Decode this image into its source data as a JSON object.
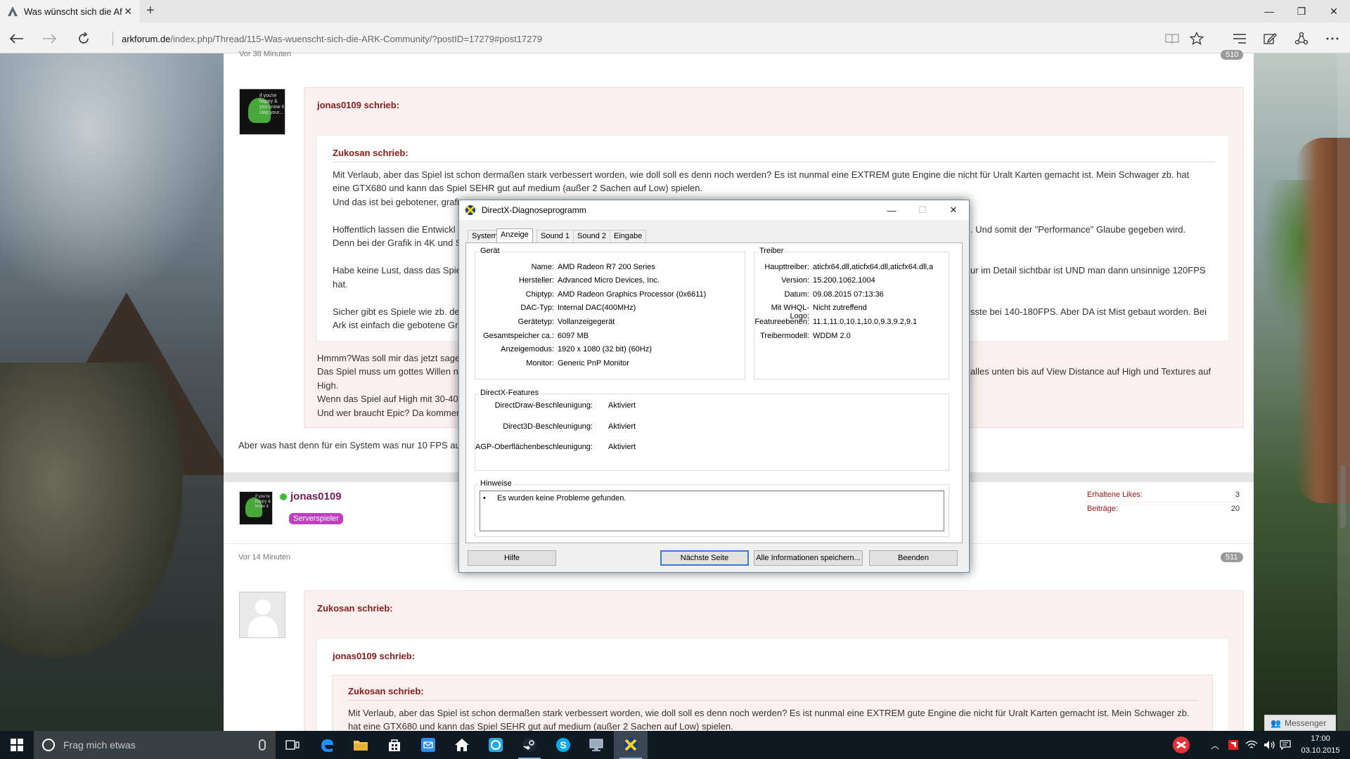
{
  "browser": {
    "tab_title": "Was wünscht sich die Af",
    "url_domain": "arkforum.de",
    "url_path": "/index.php/Thread/115-Was-wuenscht-sich-die-ARK-Community/?postID=17279#post17279"
  },
  "page": {
    "top_timestamp": "Vor 38 Minuten",
    "top_post_number": "510",
    "post1": {
      "outer_quote_author": "jonas0109 schrieb:",
      "inner_quote_author": "Zukosan schrieb:",
      "inner_quote_lines": [
        "Mit Verlaub, aber das Spiel ist schon dermaßen stark verbessert worden, wie doll soll es denn noch werden? Es ist nunmal eine EXTREM gute Engine die nicht für Uralt Karten gemacht ist. Mein Schwager zb. hat",
        "eine GTX680 und kann das Spiel SEHR gut auf medium (außer 2 Sachen auf Low) spielen.",
        "Und das ist bei gebotener, grafi",
        "Hoffentlich lassen die Entwickl",
        "Denn bei der Grafik in 4K und S",
        "Habe keine Lust, dass das Spie",
        "hat.",
        "Sicher gibt es Spiele wie zb. de",
        "Ark ist einfach die gebotene Gr"
      ],
      "inner_quote_right_fragments": [
        ". Und somit der \"Performance\" Glaube gegeben wird.",
        "ur im Detail sichtbar ist UND man dann unsinnige 120FPS",
        "sste bei 140-180FPS. Aber DA ist Mist gebaut worden. Bei"
      ],
      "outer_quote_lines": [
        "Hmmm?Was soll mir das jetzt sage",
        "Das Spiel muss um gottes Willen ni",
        "High.",
        "Wenn das Spiel auf High mit 30-40",
        "Und wer braucht Epic? Da kommen"
      ],
      "outer_quote_right_fragment": "alles unten bis auf View Distance auf High und Textures auf",
      "reply_text": "Aber was hast denn für ein System was nur 10 FPS auf"
    },
    "post2": {
      "username": "jonas0109",
      "rank_badge": "Serverspieler",
      "stats": [
        {
          "label": "Erhaltene Likes:",
          "value": "3"
        },
        {
          "label": "Beiträge:",
          "value": "20"
        }
      ],
      "timestamp": "Vor 14 Minuten",
      "post_number": "511",
      "quote_author": "Zukosan schrieb:",
      "nested_quote_author": "jonas0109 schrieb:",
      "deep_quote_author": "Zukosan schrieb:",
      "deep_quote_lines": [
        "Mit Verlaub, aber das Spiel ist schon dermaßen stark verbessert worden, wie doll soll es denn noch werden? Es ist nunmal eine EXTREM gute Engine die nicht für Uralt Karten gemacht ist. Mein Schwager zb.",
        "hat eine GTX680 und kann das Spiel SEHR gut auf medium (außer 2 Sachen auf Low) spielen."
      ]
    },
    "messenger": "Messenger"
  },
  "dxdiag": {
    "title": "DirectX-Diagnoseprogramm",
    "tabs": [
      "System",
      "Anzeige",
      "Sound 1",
      "Sound 2",
      "Eingabe"
    ],
    "active_tab": "Anzeige",
    "device_group": "Gerät",
    "device": [
      {
        "label": "Name:",
        "value": "AMD Radeon R7 200 Series"
      },
      {
        "label": "Hersteller:",
        "value": "Advanced Micro Devices, Inc."
      },
      {
        "label": "Chiptyp:",
        "value": "AMD Radeon Graphics Processor (0x6611)"
      },
      {
        "label": "DAC-Typ:",
        "value": "Internal DAC(400MHz)"
      },
      {
        "label": "Gerätetyp:",
        "value": "Vollanzeigegerät"
      },
      {
        "label": "Gesamtspeicher ca.:",
        "value": "6097 MB"
      },
      {
        "label": "Anzeigemodus:",
        "value": "1920 x 1080 (32 bit) (60Hz)"
      },
      {
        "label": "Monitor:",
        "value": "Generic PnP Monitor"
      }
    ],
    "driver_group": "Treiber",
    "driver": [
      {
        "label": "Haupttreiber:",
        "value": "aticfx64.dll,aticfx64.dll,aticfx64.dll,a"
      },
      {
        "label": "Version:",
        "value": "15.200.1062.1004"
      },
      {
        "label": "Datum:",
        "value": "09.08.2015 07:13:36"
      },
      {
        "label": "Mit WHQL-Logo:",
        "value": "Nicht zutreffend"
      },
      {
        "label": "Featureebenen:",
        "value": "11.1,11.0,10.1,10.0,9.3,9.2,9.1"
      },
      {
        "label": "Treibermodell:",
        "value": "WDDM 2.0"
      }
    ],
    "features_group": "DirectX-Features",
    "features": [
      {
        "label": "DirectDraw-Beschleunigung:",
        "value": "Aktiviert"
      },
      {
        "label": "Direct3D-Beschleunigung:",
        "value": "Aktiviert"
      },
      {
        "label": "AGP-Oberflächenbeschleunigung:",
        "value": "Aktiviert"
      }
    ],
    "notes_group": "Hinweise",
    "notes": [
      "Es wurden keine Probleme gefunden."
    ],
    "buttons": {
      "help": "Hilfe",
      "next": "Nächste Seite",
      "save_all": "Alle Informationen speichern...",
      "exit": "Beenden"
    }
  },
  "taskbar": {
    "search_placeholder": "Frag mich etwas",
    "time": "17:00",
    "date": "03.10.2015",
    "apps": [
      "task-view-icon",
      "edge-icon",
      "explorer-icon",
      "store-icon",
      "mail-icon",
      "home-icon",
      "uplay-icon",
      "steam-icon",
      "skype-icon",
      "remote-desktop-icon",
      "dxdiag-icon"
    ]
  }
}
